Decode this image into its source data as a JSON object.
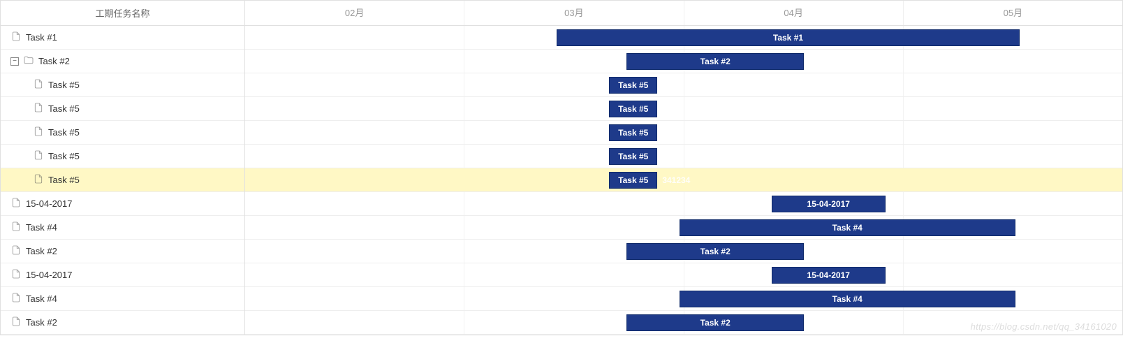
{
  "chart_data": {
    "type": "gantt",
    "time_axis": {
      "unit": "month",
      "start": "2017-02",
      "end": "2017-05",
      "ticks": [
        "02月",
        "03月",
        "04月",
        "05月"
      ]
    },
    "tree_header": "工期任务名称",
    "tasks": [
      {
        "name": "Task #1",
        "depth": 0,
        "icon": "file",
        "bar_label": "Task #1",
        "start_pct": 35.5,
        "width_pct": 52.8
      },
      {
        "name": "Task #2",
        "depth": 0,
        "icon": "folder",
        "expand": true,
        "bar_label": "Task #2",
        "start_pct": 43.5,
        "width_pct": 20.2
      },
      {
        "name": "Task #5",
        "depth": 1,
        "icon": "file",
        "bar_label": "Task #5",
        "start_pct": 41.5,
        "width_pct": 5.5
      },
      {
        "name": "Task #5",
        "depth": 1,
        "icon": "file",
        "bar_label": "Task #5",
        "start_pct": 41.5,
        "width_pct": 5.5
      },
      {
        "name": "Task #5",
        "depth": 1,
        "icon": "file",
        "bar_label": "Task #5",
        "start_pct": 41.5,
        "width_pct": 5.5
      },
      {
        "name": "Task #5",
        "depth": 1,
        "icon": "file",
        "bar_label": "Task #5",
        "start_pct": 41.5,
        "width_pct": 5.5
      },
      {
        "name": "Task #5",
        "depth": 1,
        "icon": "file",
        "bar_label": "Task #5",
        "start_pct": 41.5,
        "width_pct": 5.5,
        "selected": true,
        "annot": "341234"
      },
      {
        "name": "15-04-2017",
        "depth": 0,
        "icon": "file",
        "bar_label": "15-04-2017",
        "start_pct": 60.0,
        "width_pct": 13.0
      },
      {
        "name": "Task #4",
        "depth": 0,
        "icon": "file",
        "bar_label": "Task #4",
        "start_pct": 49.5,
        "width_pct": 38.3
      },
      {
        "name": "Task #2",
        "depth": 0,
        "icon": "file",
        "bar_label": "Task #2",
        "start_pct": 43.5,
        "width_pct": 20.2
      },
      {
        "name": "15-04-2017",
        "depth": 0,
        "icon": "file",
        "bar_label": "15-04-2017",
        "start_pct": 60.0,
        "width_pct": 13.0
      },
      {
        "name": "Task #4",
        "depth": 0,
        "icon": "file",
        "bar_label": "Task #4",
        "start_pct": 49.5,
        "width_pct": 38.3
      },
      {
        "name": "Task #2",
        "depth": 0,
        "icon": "file",
        "bar_label": "Task #2",
        "start_pct": 43.5,
        "width_pct": 20.2
      }
    ]
  },
  "watermark": "https://blog.csdn.net/qq_34161020"
}
